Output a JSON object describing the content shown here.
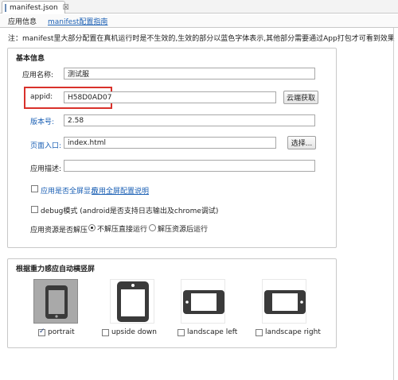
{
  "editor": {
    "tab_title": "manifest.json",
    "tab_close": "☒",
    "subtab_info": "应用信息",
    "subtab_guide": "manifest配置指南"
  },
  "notice": "注：manifest里大部分配置在真机运行时是不生效的,生效的部分以蓝色字体表示,其他部分需要通过App打包才可看到效果",
  "basic": {
    "title": "基本信息",
    "app_name_label": "应用名称:",
    "app_name_value": "测试服",
    "appid_label": "appid:",
    "appid_value": "H58D0AD07",
    "cloud_fetch_button": "云端获取",
    "version_label": "版本号:",
    "version_value": "2.58",
    "entry_label": "页面入口:",
    "entry_value": "index.html",
    "choose_button": "选择...",
    "desc_label": "应用描述:",
    "desc_value": "",
    "fullscreen_label": "应用是否全屏显示",
    "fullscreen_link": "应用全屏配置说明",
    "fullscreen_checked": false,
    "debug_label": "debug模式 (android是否支持日志输出及chrome调试)",
    "debug_checked": false,
    "unzip_label": "应用资源是否解压",
    "unzip_option_direct": "不解压直接运行",
    "unzip_option_unzip": "解压资源后运行",
    "unzip_selected": "direct"
  },
  "orientation": {
    "title": "根据重力感应自动横竖屏",
    "options": [
      {
        "label": "portrait",
        "checked": true,
        "icon": "phone-portrait-icon"
      },
      {
        "label": "upside down",
        "checked": false,
        "icon": "phone-upside-down-icon"
      },
      {
        "label": "landscape left",
        "checked": false,
        "icon": "phone-landscape-left-icon"
      },
      {
        "label": "landscape right",
        "checked": false,
        "icon": "phone-landscape-right-icon"
      }
    ]
  },
  "colors": {
    "link": "#1a5fb4",
    "highlight": "#d9312b",
    "selected_tile": "#a9a9a9",
    "phone_icon": "#3a3a3a"
  }
}
